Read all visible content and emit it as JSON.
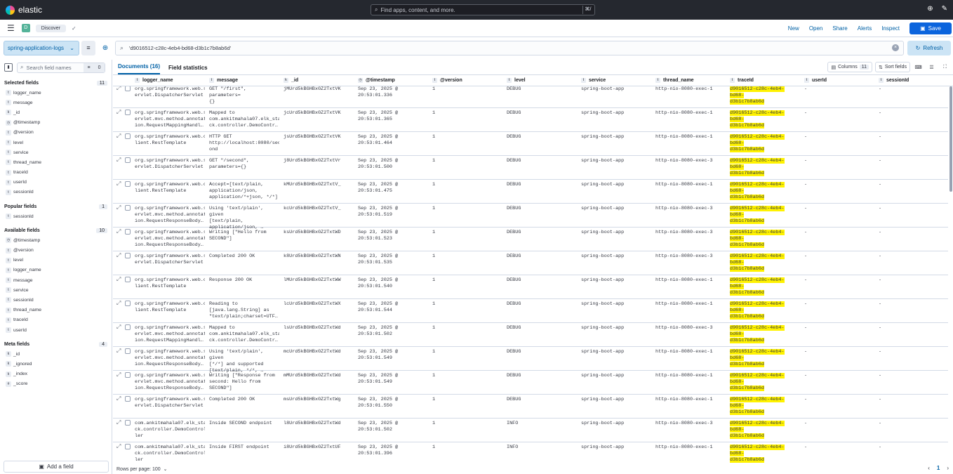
{
  "topbar": {
    "brand": "elastic",
    "search_placeholder": "Find apps, content, and more.",
    "search_shortcut": "⌘/",
    "icons": [
      "help-icon",
      "notifications-icon"
    ]
  },
  "nav": {
    "space_initial": "D",
    "breadcrumb": "Discover",
    "actions": [
      "New",
      "Open",
      "Share",
      "Alerts",
      "Inspect"
    ],
    "save_label": "Save"
  },
  "query": {
    "data_view": "spring-application-logs",
    "query_text": "'d9016512-c28c-4eb4-bd68-d3b1c7b8ab6d'",
    "refresh_label": "Refresh"
  },
  "sidebar": {
    "search_placeholder": "Search field names",
    "filter_count": "0",
    "selected": {
      "title": "Selected fields",
      "count": "11",
      "fields": [
        {
          "type": "t",
          "name": "logger_name"
        },
        {
          "type": "t",
          "name": "message"
        },
        {
          "type": "k",
          "name": "_id"
        },
        {
          "type": "◷",
          "name": "@timestamp"
        },
        {
          "type": "t",
          "name": "@version"
        },
        {
          "type": "t",
          "name": "level"
        },
        {
          "type": "t",
          "name": "service"
        },
        {
          "type": "t",
          "name": "thread_name"
        },
        {
          "type": "t",
          "name": "traceId"
        },
        {
          "type": "t",
          "name": "userId"
        },
        {
          "type": "t",
          "name": "sessionId"
        }
      ]
    },
    "popular": {
      "title": "Popular fields",
      "count": "1",
      "fields": [
        {
          "type": "t",
          "name": "sessionId"
        }
      ]
    },
    "available": {
      "title": "Available fields",
      "count": "10",
      "fields": [
        {
          "type": "◷",
          "name": "@timestamp"
        },
        {
          "type": "t",
          "name": "@version"
        },
        {
          "type": "t",
          "name": "level"
        },
        {
          "type": "t",
          "name": "logger_name"
        },
        {
          "type": "t",
          "name": "message"
        },
        {
          "type": "t",
          "name": "service"
        },
        {
          "type": "t",
          "name": "sessionId"
        },
        {
          "type": "t",
          "name": "thread_name"
        },
        {
          "type": "t",
          "name": "traceId"
        },
        {
          "type": "t",
          "name": "userId"
        }
      ]
    },
    "meta": {
      "title": "Meta fields",
      "count": "4",
      "fields": [
        {
          "type": "k",
          "name": "_id"
        },
        {
          "type": "k",
          "name": "_ignored"
        },
        {
          "type": "k",
          "name": "_index"
        },
        {
          "type": "#",
          "name": "_score"
        }
      ]
    },
    "add_field": "Add a field"
  },
  "main": {
    "tabs": [
      {
        "label": "Documents (16)",
        "active": true
      },
      {
        "label": "Field statistics",
        "active": false
      }
    ],
    "columns_label": "Columns",
    "columns_count": "11",
    "sort_label": "Sort fields",
    "headers": [
      {
        "type": "t",
        "label": "logger_name"
      },
      {
        "type": "t",
        "label": "message"
      },
      {
        "type": "k",
        "label": "_id"
      },
      {
        "type": "◷",
        "label": "@timestamp"
      },
      {
        "type": "t",
        "label": "@version"
      },
      {
        "type": "t",
        "label": "level"
      },
      {
        "type": "t",
        "label": "service"
      },
      {
        "type": "t",
        "label": "thread_name"
      },
      {
        "type": "t",
        "label": "traceId"
      },
      {
        "type": "t",
        "label": "userId"
      },
      {
        "type": "t",
        "label": "sessionId"
      }
    ],
    "rows": [
      {
        "logger": "org.springframework.web.s\nervlet.DispatcherServlet",
        "message": "GET \"/first\", parameters=\n{}",
        "id": "jMUrd5kBGHBx0Z2TxtVK",
        "ts": "Sep 23, 2025 @\n20:53:01.336",
        "version": "1",
        "level": "DEBUG",
        "service": "spring-boot-app",
        "thread": "http-nio-8080-exec-1",
        "trace": "d9016512-c28c-4eb4-bd68-\nd3b1c7b8ab6d",
        "user": "-",
        "session": "-"
      },
      {
        "logger": "org.springframework.web.s\nervlet.mvc.method.annotat\nion.RequestMappingHandl…",
        "message": "Mapped to\ncom.ankitmahala07.elk_sta\nck.controller.DemoContr…",
        "id": "jcUrd5kBGHBx0Z2TxtVK",
        "ts": "Sep 23, 2025 @\n20:53:01.365",
        "version": "1",
        "level": "DEBUG",
        "service": "spring-boot-app",
        "thread": "http-nio-8080-exec-1",
        "trace": "d9016512-c28c-4eb4-bd68-\nd3b1c7b8ab6d",
        "user": "-",
        "session": "-"
      },
      {
        "logger": "org.springframework.web.c\nlient.RestTemplate",
        "message": "HTTP GET\nhttp://localhost:8080/sec\nond",
        "id": "jsUrd5kBGHBx0Z2TxtVK",
        "ts": "Sep 23, 2025 @\n20:53:01.464",
        "version": "1",
        "level": "DEBUG",
        "service": "spring-boot-app",
        "thread": "http-nio-8080-exec-1",
        "trace": "d9016512-c28c-4eb4-bd68-\nd3b1c7b8ab6d",
        "user": "-",
        "session": "-"
      },
      {
        "logger": "org.springframework.web.s\nervlet.DispatcherServlet",
        "message": "GET \"/second\",\nparameters={}",
        "id": "j8Urd5kBGHBx0Z2TxtVr",
        "ts": "Sep 23, 2025 @\n20:53:01.500",
        "version": "1",
        "level": "DEBUG",
        "service": "spring-boot-app",
        "thread": "http-nio-8080-exec-3",
        "trace": "d9016512-c28c-4eb4-bd68-\nd3b1c7b8ab6d",
        "user": "-",
        "session": "-"
      },
      {
        "logger": "org.springframework.web.c\nlient.RestTemplate",
        "message": "Accept=[text/plain,\napplication/json,\napplication/*+json, */*]",
        "id": "kMUrd5kBGHBx0Z2TxtV_",
        "ts": "Sep 23, 2025 @\n20:53:01.475",
        "version": "1",
        "level": "DEBUG",
        "service": "spring-boot-app",
        "thread": "http-nio-8080-exec-1",
        "trace": "d9016512-c28c-4eb4-bd68-\nd3b1c7b8ab6d",
        "user": "-",
        "session": "-"
      },
      {
        "logger": "org.springframework.web.s\nervlet.mvc.method.annotat\nion.RequestResponseBody…",
        "message": "Using 'text/plain', given\n[text/plain,\napplication/json, …",
        "id": "kcUrd5kBGHBx0Z2TxtV_",
        "ts": "Sep 23, 2025 @\n20:53:01.519",
        "version": "1",
        "level": "DEBUG",
        "service": "spring-boot-app",
        "thread": "http-nio-8080-exec-3",
        "trace": "d9016512-c28c-4eb4-bd68-\nd3b1c7b8ab6d",
        "user": "-",
        "session": "-"
      },
      {
        "logger": "org.springframework.web.s\nervlet.mvc.method.annotat\nion.RequestResponseBody…",
        "message": "Writing [\"Hello from\nSECOND\"]",
        "id": "ksUrd5kBGHBx0Z2TxtWD",
        "ts": "Sep 23, 2025 @\n20:53:01.523",
        "version": "1",
        "level": "DEBUG",
        "service": "spring-boot-app",
        "thread": "http-nio-8080-exec-3",
        "trace": "d9016512-c28c-4eb4-bd68-\nd3b1c7b8ab6d",
        "user": "-",
        "session": "-"
      },
      {
        "logger": "org.springframework.web.s\nervlet.DispatcherServlet",
        "message": "Completed 200 OK",
        "id": "k8Urd5kBGHBx0Z2TxtWN",
        "ts": "Sep 23, 2025 @\n20:53:01.535",
        "version": "1",
        "level": "DEBUG",
        "service": "spring-boot-app",
        "thread": "http-nio-8080-exec-3",
        "trace": "d9016512-c28c-4eb4-bd68-\nd3b1c7b8ab6d",
        "user": "-",
        "session": "-"
      },
      {
        "logger": "org.springframework.web.c\nlient.RestTemplate",
        "message": "Response 200 OK",
        "id": "lMUrd5kBGHBx0Z2TxtWW",
        "ts": "Sep 23, 2025 @\n20:53:01.540",
        "version": "1",
        "level": "DEBUG",
        "service": "spring-boot-app",
        "thread": "http-nio-8080-exec-1",
        "trace": "d9016512-c28c-4eb4-bd68-\nd3b1c7b8ab6d",
        "user": "-",
        "session": "-"
      },
      {
        "logger": "org.springframework.web.c\nlient.RestTemplate",
        "message": "Reading to\n[java.lang.String] as\n\"text/plain;charset=UTF…",
        "id": "lcUrd5kBGHBx0Z2TxtWX",
        "ts": "Sep 23, 2025 @\n20:53:01.544",
        "version": "1",
        "level": "DEBUG",
        "service": "spring-boot-app",
        "thread": "http-nio-8080-exec-1",
        "trace": "d9016512-c28c-4eb4-bd68-\nd3b1c7b8ab6d",
        "user": "-",
        "session": "-"
      },
      {
        "logger": "org.springframework.web.s\nervlet.mvc.method.annotat\nion.RequestMappingHandl…",
        "message": "Mapped to\ncom.ankitmahala07.elk_sta\nck.controller.DemoContr…",
        "id": "lsUrd5kBGHBx0Z2TxtWd",
        "ts": "Sep 23, 2025 @\n20:53:01.502",
        "version": "1",
        "level": "DEBUG",
        "service": "spring-boot-app",
        "thread": "http-nio-8080-exec-3",
        "trace": "d9016512-c28c-4eb4-bd68-\nd3b1c7b8ab6d",
        "user": "-",
        "session": "-"
      },
      {
        "logger": "org.springframework.web.s\nervlet.mvc.method.annotat\nion.RequestResponseBody…",
        "message": "Using 'text/plain', given\n[*/*] and supported\n[text/plain, */*, …",
        "id": "mcUrd5kBGHBx0Z2TxtWd",
        "ts": "Sep 23, 2025 @\n20:53:01.549",
        "version": "1",
        "level": "DEBUG",
        "service": "spring-boot-app",
        "thread": "http-nio-8080-exec-1",
        "trace": "d9016512-c28c-4eb4-bd68-\nd3b1c7b8ab6d",
        "user": "-",
        "session": "-"
      },
      {
        "logger": "org.springframework.web.s\nervlet.mvc.method.annotat\nion.RequestResponseBody…",
        "message": "Writing [\"Response from\nsecond: Hello from\nSECOND\"]",
        "id": "mMUrd5kBGHBx0Z2TxtWd",
        "ts": "Sep 23, 2025 @\n20:53:01.549",
        "version": "1",
        "level": "DEBUG",
        "service": "spring-boot-app",
        "thread": "http-nio-8080-exec-1",
        "trace": "d9016512-c28c-4eb4-bd68-\nd3b1c7b8ab6d",
        "user": "-",
        "session": "-"
      },
      {
        "logger": "org.springframework.web.s\nervlet.DispatcherServlet",
        "message": "Completed 200 OK",
        "id": "msUrd5kBGHBx0Z2TxtWg",
        "ts": "Sep 23, 2025 @\n20:53:01.550",
        "version": "1",
        "level": "DEBUG",
        "service": "spring-boot-app",
        "thread": "http-nio-8080-exec-1",
        "trace": "d9016512-c28c-4eb4-bd68-\nd3b1c7b8ab6d",
        "user": "-",
        "session": "-"
      },
      {
        "logger": "com.ankitmahala07.elk_sta\nck.controller.DemoControl\nler",
        "message": "Inside SECOND endpoint",
        "id": "l8Urd5kBGHBx0Z2TxtWd",
        "ts": "Sep 23, 2025 @\n20:53:01.502",
        "version": "1",
        "level": "INFO",
        "service": "spring-boot-app",
        "thread": "http-nio-8080-exec-3",
        "trace": "d9016512-c28c-4eb4-bd68-\nd3b1c7b8ab6d",
        "user": "-",
        "session": "-"
      },
      {
        "logger": "com.ankitmahala07.elk_sta\nck.controller.DemoControl\nler",
        "message": "Inside FIRST endpoint",
        "id": "i8Urd5kBGHBx0Z2TxtUF",
        "ts": "Sep 23, 2025 @\n20:53:01.396",
        "version": "1",
        "level": "INFO",
        "service": "spring-boot-app",
        "thread": "http-nio-8080-exec-1",
        "trace": "d9016512-c28c-4eb4-bd68-\nd3b1c7b8ab6d",
        "user": "-",
        "session": "-"
      }
    ],
    "rows_per_page": "Rows per page: 100",
    "current_page": "1"
  },
  "colors": {
    "highlight": "#fff200",
    "accent": "#0061a6",
    "save_button": "#0b64dd"
  }
}
